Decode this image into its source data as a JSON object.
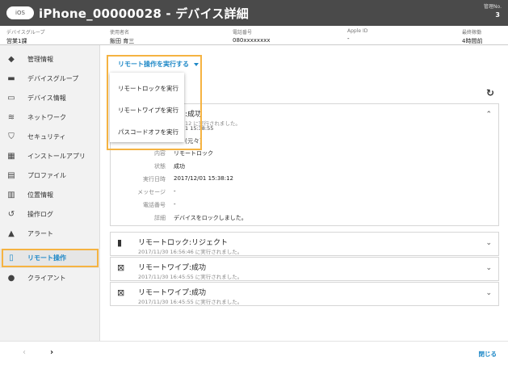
{
  "header": {
    "os_badge": "iOS",
    "title": "iPhone_00000028 - デバイス詳細",
    "mgmt_label": "管理No.",
    "mgmt_number": "3"
  },
  "info": [
    {
      "label": "デバイスグループ",
      "value": "営業1課"
    },
    {
      "label": "使用者名",
      "value": "飯田 育三"
    },
    {
      "label": "電話番号",
      "value": "080xxxxxxxx"
    },
    {
      "label": "Apple ID",
      "value": "-"
    },
    {
      "label": "最終稼働",
      "value": "4時間前"
    }
  ],
  "sidebar": {
    "items": [
      {
        "label": "管理情報",
        "icon": "tag-icon"
      },
      {
        "label": "デバイスグループ",
        "icon": "folder-icon"
      },
      {
        "label": "デバイス情報",
        "icon": "devices-icon"
      },
      {
        "label": "ネットワーク",
        "icon": "wifi-icon"
      },
      {
        "label": "セキュリティ",
        "icon": "shield-icon"
      },
      {
        "label": "インストールアプリ",
        "icon": "apps-grid-icon"
      },
      {
        "label": "プロファイル",
        "icon": "document-icon"
      },
      {
        "label": "位置情報",
        "icon": "map-icon"
      },
      {
        "label": "操作ログ",
        "icon": "history-icon"
      },
      {
        "label": "アラート",
        "icon": "warning-icon"
      },
      {
        "label": "リモート操作",
        "icon": "remote-phone-icon"
      },
      {
        "label": "クライアント",
        "icon": "client-icon"
      }
    ],
    "active_index": 10
  },
  "dropdown": {
    "label": "リモート操作を実行する",
    "items": [
      "リモートロックを実行",
      "リモートワイプを実行",
      "パスコードオフを実行"
    ]
  },
  "panels": {
    "expanded": {
      "title_partial": ":成功",
      "sub_partial": "12 に実行されました。",
      "line3": "1 15:38:55",
      "line4": "(元々)",
      "details": [
        {
          "key": "内容",
          "value": "リモートロック"
        },
        {
          "key": "状態",
          "value": "成功"
        },
        {
          "key": "実行日時",
          "value": "2017/12/01 15:38:12"
        },
        {
          "key": "メッセージ",
          "value": "-"
        },
        {
          "key": "電話番号",
          "value": "-"
        },
        {
          "key": "詳細",
          "value": "デバイスをロックしました。"
        }
      ]
    },
    "collapsed": [
      {
        "title": "リモートロック:リジェクト",
        "sub": "2017/11/30 16:56:46 に実行されました。",
        "icon": "lock-phone-icon"
      },
      {
        "title": "リモートワイプ:成功",
        "sub": "2017/11/30 16:45:55 に実行されました。",
        "icon": "wipe-phone-icon"
      },
      {
        "title": "リモートワイプ:成功",
        "sub": "2017/11/30 16:45:55 に実行されました。",
        "icon": "wipe-phone-icon"
      }
    ]
  },
  "footer": {
    "prev": "‹",
    "next": "›",
    "close": "閉じる"
  }
}
